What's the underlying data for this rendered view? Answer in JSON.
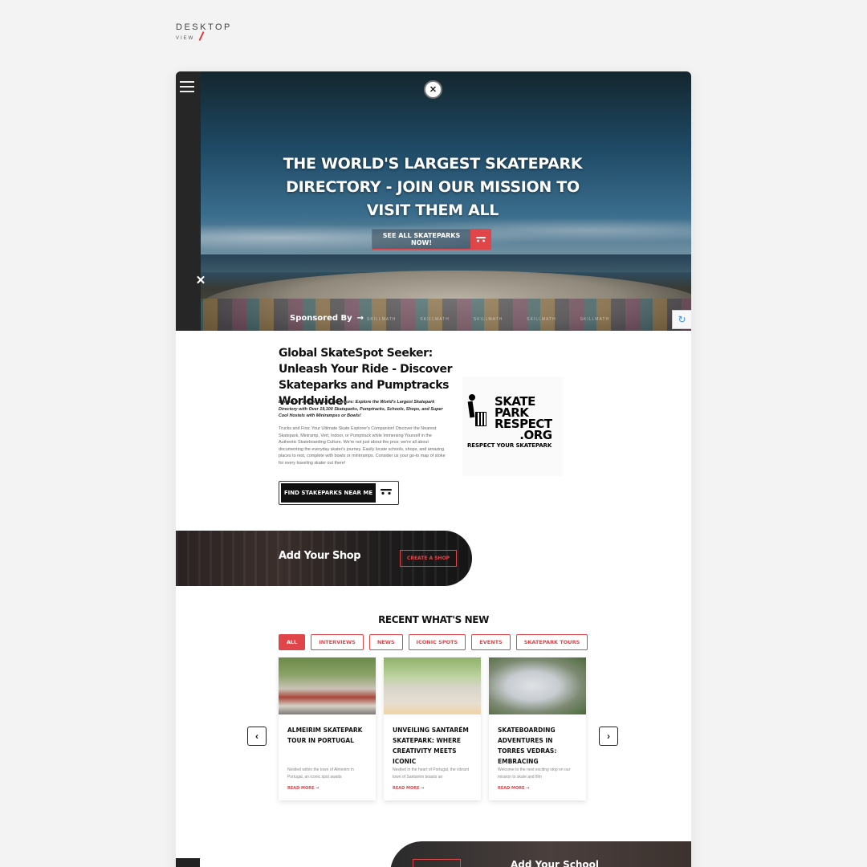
{
  "header_label": {
    "title": "DESKTOP",
    "subtitle": "VIEW"
  },
  "hero": {
    "title": "THE WORLD'S LARGEST SKATEPARK DIRECTORY - JOIN OUR MISSION TO VISIT THEM ALL",
    "cta_label": "SEE ALL SKATEPARKS NOW!",
    "sponsored_label": "Sponsored By",
    "sponsors": [
      "SKILLMATH",
      "SKILLMATH",
      "SKILLMATH",
      "SKILLMATH",
      "SKILLMATH"
    ]
  },
  "intro": {
    "title": "Global SkateSpot Seeker: Unleash Your Ride - Discover Skateparks and Pumptracks Worldwide!",
    "lead": "Embark on an Epic Skate Adventure: Explore the World's Largest Skatepark Directory with Over 19,100 Skateparks, Pumptracks, Schools, Shops, and Super Cool Hostels with Minirampss or Bowls!",
    "body": "Trucks and Fins: Your Ultimate Skate Explorer's Companion! Discover the Nearest Skatepark, Miniramp, Vert, Indoor, or Pumptrack while Immersing Yourself in the Authentic Skateboarding Culture. We're not just about the pros; we're all about documenting the everyday skater's journey. Easily locate schools, shops, and amazing places to rest, complete with bowls or minirramps. Consider us your go-to map of stoke for every traveling skater out there!",
    "cta_label": "FIND STAKEPARKS NEAR ME"
  },
  "respect_logo": {
    "line1": "SKATE",
    "line2": "PARK",
    "line3": "RESPECT",
    "line4": ".ORG",
    "tagline": "RESPECT YOUR SKATEPARK"
  },
  "shop_banner": {
    "title": "Add Your Shop",
    "button": "CREATE A SHOP"
  },
  "news": {
    "title": "RECENT WHAT'S NEW",
    "filters": [
      "ALL",
      "INTERVIEWS",
      "NEWS",
      "ICONIC SPOTS",
      "EVENTS",
      "SKATEPARK TOURS"
    ],
    "cards": [
      {
        "title": "ALMEIRIM SKATEPARK TOUR IN PORTUGAL",
        "excerpt": "Nestled within the town of Almeirim in Portugal, an iconic spot awaits",
        "more": "READ MORE →"
      },
      {
        "title": "UNVEILING SANTARÉM SKATEPARK: WHERE CREATIVITY MEETS ICONIC",
        "excerpt": "Nestled in the heart of Portugal, the vibrant town of Santarém boasts an",
        "more": "READ MORE →"
      },
      {
        "title": "SKATEBOARDING ADVENTURES IN TORRES VEDRAS: EMBRACING",
        "excerpt": "Welcome to the next exciting stop on our mission to skate and film",
        "more": "READ MORE →"
      }
    ],
    "prev": "‹",
    "next": "›"
  },
  "bottom_banner": {
    "title": "Add Your School"
  },
  "colors": {
    "accent": "#e0454a",
    "dark": "#262626"
  },
  "icons": [
    "menu-icon",
    "close-icon",
    "skateboard-icon",
    "recaptcha-icon",
    "chevron-left-icon",
    "chevron-right-icon"
  ]
}
